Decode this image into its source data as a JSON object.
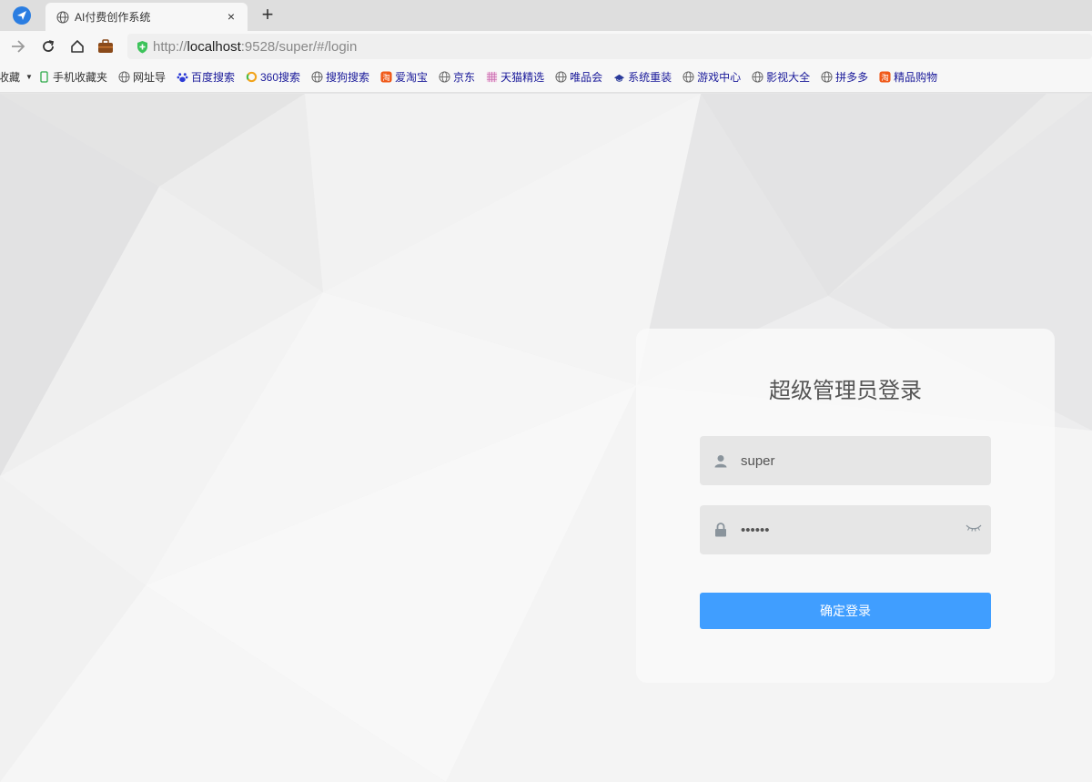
{
  "browser": {
    "tab_title": "AI付费创作系统",
    "tab_close": "×",
    "new_tab": "+",
    "url_prefix": "http://",
    "url_host": "localhost",
    "url_rest": ":9528/super/#/login"
  },
  "bookmarks": [
    {
      "label": "收藏",
      "icon": "star-icon"
    },
    {
      "label": "手机收藏夹",
      "icon": "phone-icon"
    },
    {
      "label": "网址导",
      "icon": "globe-icon"
    },
    {
      "label": "百度搜索",
      "icon": "baidu-icon"
    },
    {
      "label": "360搜索",
      "icon": "360-icon"
    },
    {
      "label": "搜狗搜索",
      "icon": "globe-icon"
    },
    {
      "label": "爱淘宝",
      "icon": "taobao-icon"
    },
    {
      "label": "京东",
      "icon": "globe-icon"
    },
    {
      "label": "天猫精选",
      "icon": "tmall-icon"
    },
    {
      "label": "唯品会",
      "icon": "globe-icon"
    },
    {
      "label": "系统重装",
      "icon": "hat-icon"
    },
    {
      "label": "游戏中心",
      "icon": "globe-icon"
    },
    {
      "label": "影视大全",
      "icon": "globe-icon"
    },
    {
      "label": "拼多多",
      "icon": "globe-icon"
    },
    {
      "label": "精品购物",
      "icon": "taobao-icon"
    }
  ],
  "login": {
    "title": "超级管理员登录",
    "username_value": "super",
    "password_value": "••••••",
    "submit_label": "确定登录"
  },
  "colors": {
    "primary": "#409eff",
    "tab_home": "#2a7de1",
    "shield": "#3cc35a"
  }
}
